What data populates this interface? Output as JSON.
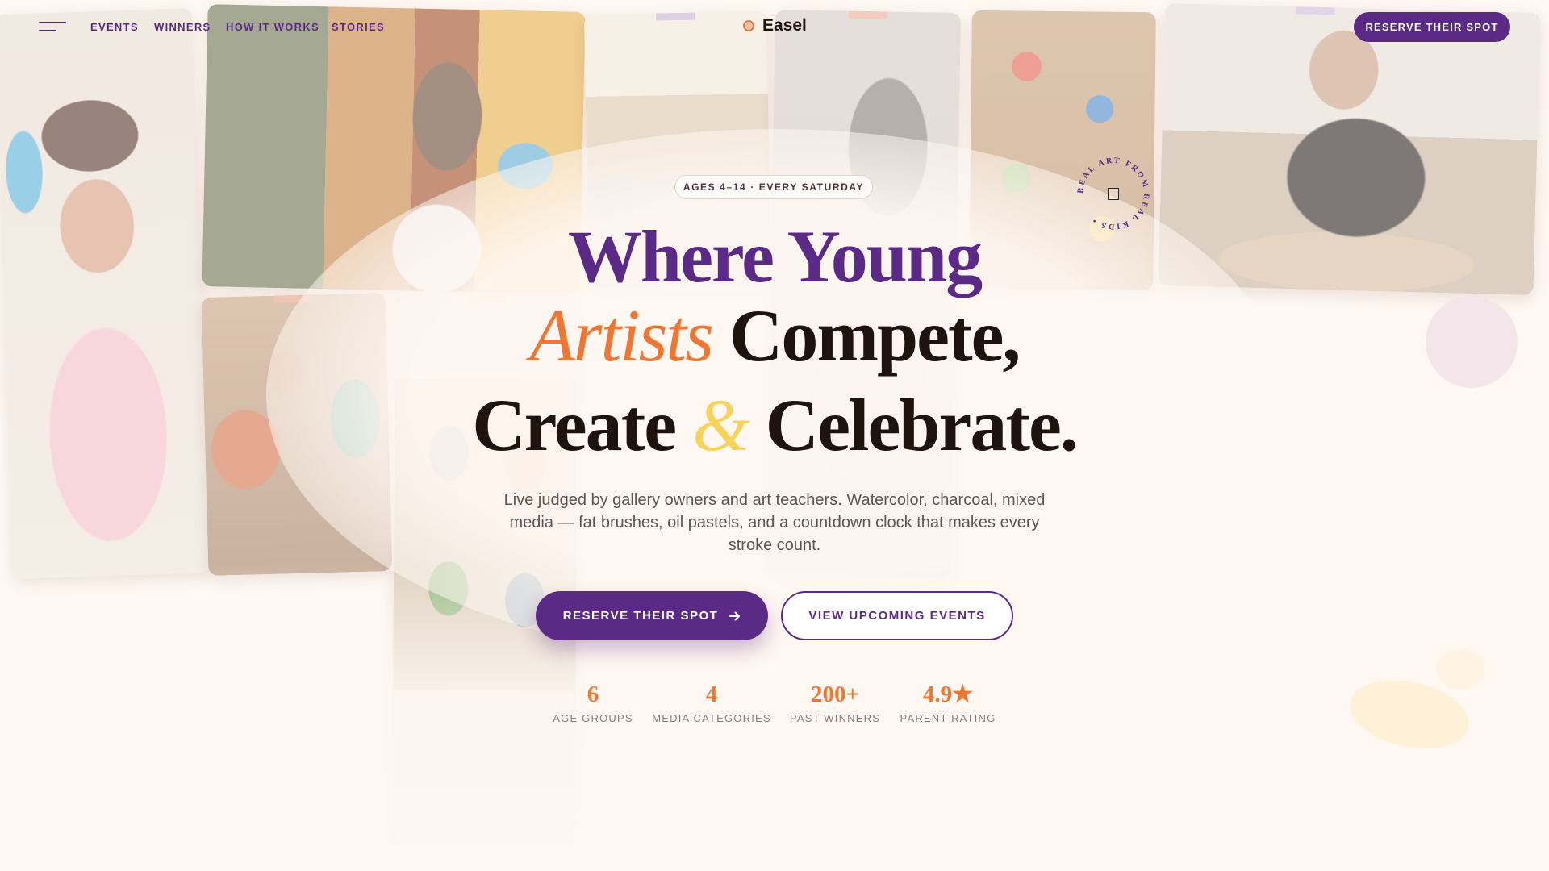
{
  "nav": {
    "links": [
      "EVENTS",
      "WINNERS",
      "HOW IT WORKS",
      "STORIES"
    ],
    "brand": "Easel",
    "cta": "RESERVE THEIR SPOT"
  },
  "hero": {
    "pill": "AGES 4–14 · EVERY SATURDAY",
    "headline": {
      "line1": "Where Young",
      "line2_accent": "Artists",
      "line2_rest": " Compete,",
      "line3_a": "Create ",
      "line3_amp": "&",
      "line3_b": " Celebrate."
    },
    "subtitle": "Live judged by gallery owners and art teachers. Watercolor, charcoal, mixed media — fat brushes, oil pastels, and a countdown clock that makes every stroke count.",
    "primary_cta": "RESERVE THEIR SPOT",
    "secondary_cta": "VIEW UPCOMING EVENTS"
  },
  "stats": [
    {
      "value": "6",
      "label": "AGE GROUPS"
    },
    {
      "value": "4",
      "label": "MEDIA CATEGORIES"
    },
    {
      "value": "200+",
      "label": "PAST WINNERS"
    },
    {
      "value": "4.9★",
      "label": "PARENT RATING"
    }
  ],
  "badge": {
    "text": "REAL ART FROM REAL KIDS • "
  },
  "colors": {
    "background": "#fff7f1",
    "primary_purple": "#5b2a86",
    "accent_orange": "#ef7733",
    "accent_yellow": "#f8d35a",
    "ink": "#1f140d"
  },
  "icons": {
    "menu": "hamburger-menu-icon",
    "logo": "palette-logo-icon",
    "arrow": "arrow-right-icon"
  }
}
